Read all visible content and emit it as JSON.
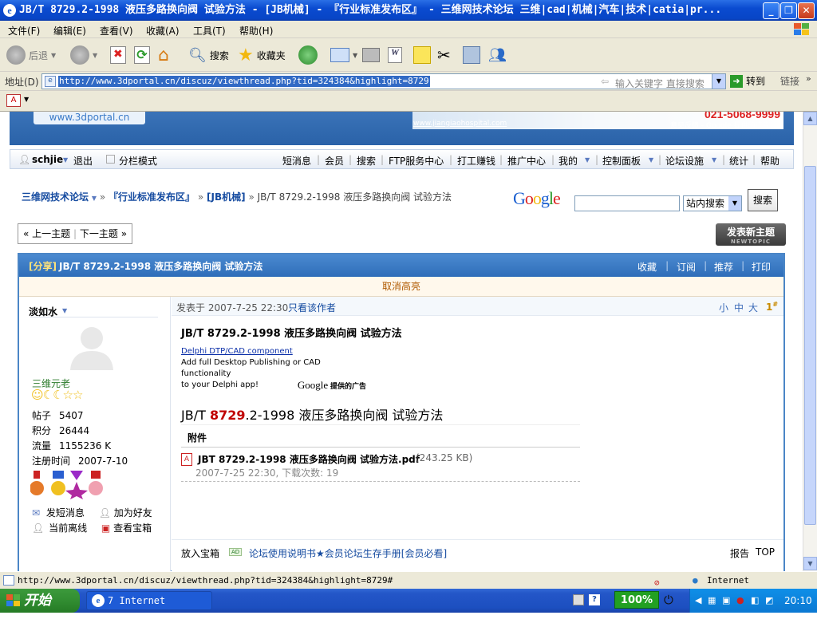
{
  "window": {
    "title": "JB/T 8729.2-1998 液压多路换向阀 试验方法 - [JB机械] - 『行业标准发布区』 - 三维网技术论坛 三维|cad|机械|汽车|技术|catia|pr...",
    "minimize": "_",
    "restore": "❐",
    "close": "✕"
  },
  "menu": [
    "文件(F)",
    "编辑(E)",
    "查看(V)",
    "收藏(A)",
    "工具(T)",
    "帮助(H)"
  ],
  "toolbar": {
    "back": "后退",
    "search": "搜索",
    "favorites": "收藏夹"
  },
  "address": {
    "label": "地址(D)",
    "url": "http://www.3dportal.cn/discuz/viewthread.php?tid=324384&highlight=8729",
    "search_hint": "输入关键字 直接搜索",
    "go": "转到",
    "links": "链接"
  },
  "banner": {
    "site_link": "www.3dportal.cn",
    "ad_link": "www.jiangiaohospital.com",
    "ad_phone": "021-5068-9999",
    "ad_small": "意见反馈 - Google 提供的广告"
  },
  "navbar": {
    "user": "schjie",
    "logout": "退出",
    "split_mode": "分栏模式",
    "items": [
      "短消息",
      "会员",
      "搜索",
      "FTP服务中心",
      "打工赚钱",
      "推广中心",
      "我的",
      "控制面板",
      "论坛设施",
      "统计",
      "帮助"
    ]
  },
  "breadcrumb": {
    "forum": "三维网技术论坛",
    "section": "『行业标准发布区』",
    "board": "[JB机械]",
    "thread": "JB/T 8729.2-1998 液压多路换向阀 试验方法"
  },
  "google_search": {
    "logo": "Google",
    "scope": "站内搜索",
    "button": "搜索"
  },
  "thread_nav": {
    "prev": "« 上一主题",
    "next": "下一主题 »"
  },
  "new_topic": {
    "label": "发表新主题",
    "sub": "NEWTOPIC"
  },
  "post": {
    "tag": "[分享]",
    "title": "JB/T 8729.2-1998 液压多路换向阀 试验方法",
    "actions": [
      "收藏",
      "订阅",
      "推荐",
      "打印"
    ],
    "cancel_highlight": "取消高亮",
    "posted_at": "发表于 2007-7-25 22:30",
    "only_author": "只看该作者",
    "font_sizes": [
      "小",
      "中",
      "大"
    ],
    "floor": "1",
    "floor_sup": "#",
    "heading": "JB/T 8729.2-1998 液压多路换向阀 试验方法",
    "ad_title": "Delphi DTP/CAD component",
    "ad_text1": "Add full Desktop Publishing or CAD functionality",
    "ad_text2": "to your Delphi app!",
    "ad_google": "Google",
    "ad_google_sub": "提供的广告",
    "body_prefix": "JB/T ",
    "body_highlight": "8729",
    "body_suffix": ".2-1998 液压多路换向阀 试验方法",
    "attachment_title": "附件",
    "attachment_name": "JBT 8729.2-1998 液压多路换向阀 试验方法.pdf",
    "attachment_size": "(243.25 KB)",
    "attachment_meta": "2007-7-25 22:30, 下载次数: 19",
    "footer_treasure": "放入宝箱",
    "footer_ad_badge": "AD",
    "footer_link": "论坛使用说明书★会员论坛生存手册[会员必看]",
    "report": "报告",
    "top": "TOP"
  },
  "author": {
    "name": "淡如水",
    "rank": "三维元老",
    "stats": [
      {
        "label": "帖子",
        "value": "5407"
      },
      {
        "label": "积分",
        "value": "26444"
      },
      {
        "label": "流量",
        "value": "1155236 K"
      },
      {
        "label": "注册时间",
        "value": "2007-7-10"
      }
    ],
    "send_msg": "发短消息",
    "add_friend": "加为好友",
    "status": "当前离线",
    "view_treasure": "查看宝箱"
  },
  "statusbar": {
    "url": "http://www.3dportal.cn/discuz/viewthread.php?tid=324384&highlight=8729#",
    "zone": "Internet"
  },
  "taskbar": {
    "start": "开始",
    "task": "7 Internet Expl...",
    "zoom": "100%",
    "clock": "20:10"
  },
  "colors": {
    "accent": "#2e6db9",
    "highlight_red": "#c00000",
    "link_blue": "#154ba0"
  }
}
